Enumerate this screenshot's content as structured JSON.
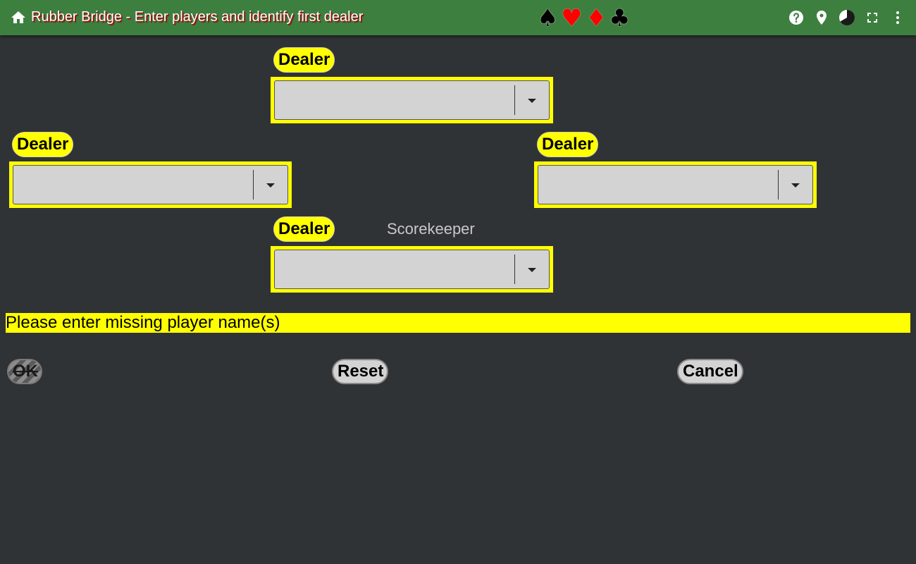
{
  "header": {
    "title": "Rubber Bridge - Enter players and identify first dealer",
    "suits": [
      "♠",
      "♥",
      "♦",
      "♣"
    ],
    "icons": [
      "home-icon",
      "help-icon",
      "location-pin-icon",
      "theme-pie-icon",
      "fullscreen-icon",
      "more-vert-icon"
    ]
  },
  "players": {
    "north": {
      "badge": "Dealer",
      "value": ""
    },
    "west": {
      "badge": "Dealer",
      "value": ""
    },
    "east": {
      "badge": "Dealer",
      "value": ""
    },
    "south": {
      "badge": "Dealer",
      "value": "",
      "role_label": "Scorekeeper"
    }
  },
  "message": "Please enter missing player name(s)",
  "buttons": {
    "ok": "OK",
    "reset": "Reset",
    "cancel": "Cancel"
  },
  "colors": {
    "header_bg": "#3d7f3f",
    "page_bg": "#303336",
    "highlight": "#ffff00",
    "button_bg": "#d3d3d3",
    "title_shadow": "#8b1a10"
  }
}
